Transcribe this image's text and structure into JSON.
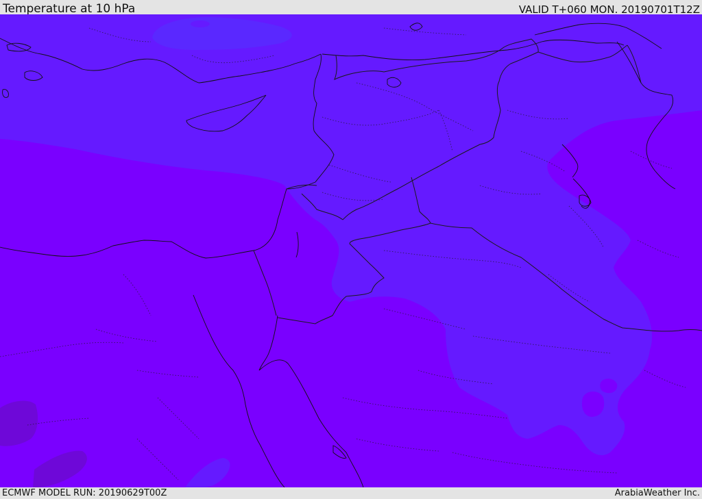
{
  "header": {
    "title": "Temperature at 10 hPa",
    "valid": "VALID T+060 MON. 20190701T12Z"
  },
  "footer": {
    "model_run": "ECMWF MODEL RUN: 20190629T00Z",
    "credit": "ArabiaWeather Inc."
  },
  "map": {
    "region": "Eastern Mediterranean and Middle East",
    "fill_colors": {
      "background": "#7a00ff",
      "cooler_band": "#651aff",
      "coolest_patch": "#5a28ff",
      "warmer_patch": "#6e08d8"
    },
    "line_colors": {
      "coastline": "#111111",
      "border": "#1a1a1a"
    }
  }
}
